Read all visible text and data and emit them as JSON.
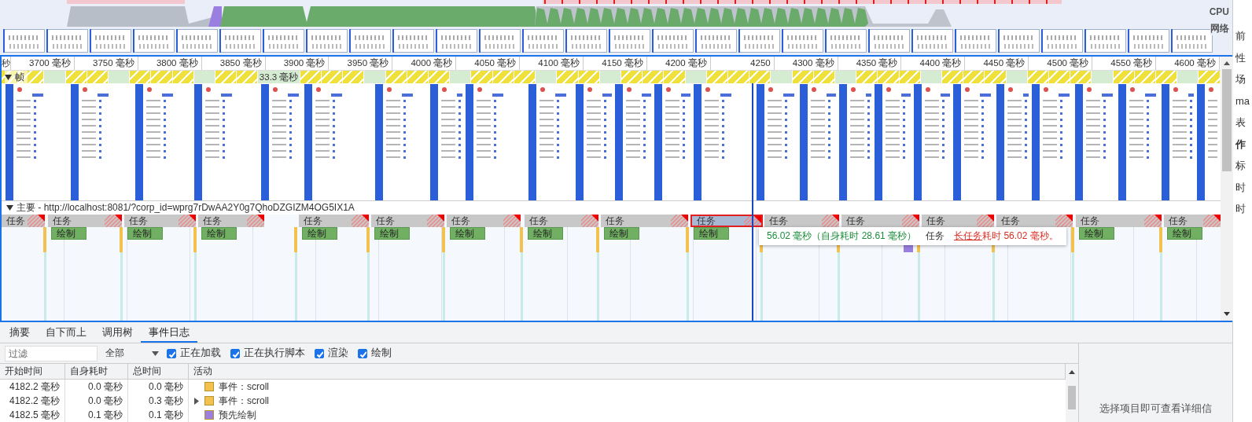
{
  "overview": {
    "cpu_label": "CPU",
    "network_label": "网络"
  },
  "side_panel": [
    {
      "text": "前",
      "emphasized": false
    },
    {
      "text": "性",
      "emphasized": false
    },
    {
      "text": "场",
      "emphasized": false
    },
    {
      "text": "ma",
      "emphasized": false
    },
    {
      "text": "表",
      "emphasized": false
    },
    {
      "text": "作",
      "emphasized": true
    },
    {
      "text": "标",
      "emphasized": false
    },
    {
      "text": "时",
      "emphasized": false
    },
    {
      "text": "时",
      "emphasized": false
    }
  ],
  "ruler": [
    "秒",
    "3700 毫秒",
    "3750 毫秒",
    "3800 毫秒",
    "3850 毫秒",
    "3900 毫秒",
    "3950 毫秒",
    "4000 毫秒",
    "4050 毫秒",
    "4100 毫秒",
    "4150 毫秒",
    "4200 毫秒",
    "4250",
    "4300 毫秒",
    "4350 毫秒",
    "4400 毫秒",
    "4450 毫秒",
    "4500 毫秒",
    "4550 毫秒",
    "4600 毫秒"
  ],
  "frames": {
    "label": "帧",
    "expanded": true,
    "items": [
      {
        "kind": "dropped"
      },
      {
        "kind": "dropped"
      },
      {
        "kind": "idle"
      },
      {
        "kind": "dropped"
      },
      {
        "kind": "dropped"
      },
      {
        "kind": "idle"
      },
      {
        "kind": "dropped"
      },
      {
        "kind": "dropped"
      },
      {
        "kind": "dropped"
      },
      {
        "kind": "idle"
      },
      {
        "kind": "dropped"
      },
      {
        "kind": "dropped"
      },
      {
        "kind": "idle",
        "label": "33.3 毫秒"
      },
      {
        "kind": "dropped"
      },
      {
        "kind": "dropped"
      },
      {
        "kind": "dropped"
      },
      {
        "kind": "idle"
      },
      {
        "kind": "dropped"
      },
      {
        "kind": "dropped"
      },
      {
        "kind": "dropped"
      },
      {
        "kind": "idle"
      },
      {
        "kind": "dropped"
      },
      {
        "kind": "dropped"
      },
      {
        "kind": "dropped"
      },
      {
        "kind": "idle"
      },
      {
        "kind": "dropped"
      },
      {
        "kind": "dropped"
      },
      {
        "kind": "idle"
      },
      {
        "kind": "dropped"
      },
      {
        "kind": "dropped"
      },
      {
        "kind": "dropped"
      },
      {
        "kind": "idle"
      },
      {
        "kind": "dropped"
      },
      {
        "kind": "dropped"
      },
      {
        "kind": "dropped"
      },
      {
        "kind": "idle"
      },
      {
        "kind": "dropped"
      },
      {
        "kind": "dropped"
      },
      {
        "kind": "idle"
      },
      {
        "kind": "dropped"
      },
      {
        "kind": "dropped"
      },
      {
        "kind": "dropped"
      },
      {
        "kind": "idle"
      },
      {
        "kind": "dropped"
      },
      {
        "kind": "dropped"
      },
      {
        "kind": "dropped"
      },
      {
        "kind": "idle"
      },
      {
        "kind": "dropped"
      },
      {
        "kind": "dropped"
      },
      {
        "kind": "dropped"
      },
      {
        "kind": "idle"
      },
      {
        "kind": "dropped"
      },
      {
        "kind": "dropped"
      },
      {
        "kind": "dropped"
      },
      {
        "kind": "idle"
      },
      {
        "kind": "dropped"
      }
    ]
  },
  "main_thread": {
    "title": "主要 - http://localhost:8081/?corp_id=wprg7rDwAA2Y0g7QhoDZGIZM4OG5IX1A",
    "expanded": true,
    "tasks": [
      {
        "label": "任务",
        "long_task": true,
        "selected": false
      },
      {
        "label": "任务",
        "paint": "绘制",
        "long_task": true,
        "selected": false
      },
      {
        "label": "任务",
        "paint": "绘制",
        "long_task": true,
        "selected": false
      },
      {
        "label": "任务",
        "paint": "绘制",
        "long_task": true,
        "selected": false
      },
      {
        "label": "任务",
        "paint": "绘制",
        "long_task": true,
        "selected": false
      },
      {
        "label": "任务",
        "paint": "绘制",
        "long_task": true,
        "selected": false
      },
      {
        "label": "任务",
        "paint": "绘制",
        "long_task": true,
        "selected": false
      },
      {
        "label": "任务",
        "paint": "绘制",
        "long_task": true,
        "selected": false
      },
      {
        "label": "任务",
        "paint": "绘制",
        "long_task": true,
        "selected": false
      },
      {
        "label": "任务",
        "paint": "绘制",
        "long_task": true,
        "selected": true
      },
      {
        "label": "任务",
        "long_task": true,
        "selected": false
      },
      {
        "label": "任务",
        "long_task": true,
        "selected": false
      },
      {
        "label": "任务",
        "long_task": true,
        "selected": false
      },
      {
        "label": "任务",
        "long_task": true,
        "selected": false
      },
      {
        "label": "任务",
        "paint": "绘制",
        "long_task": true,
        "selected": false
      },
      {
        "label": "任务",
        "paint": "绘制",
        "long_task": true,
        "selected": false
      }
    ],
    "tooltip": {
      "duration": "56.02 毫秒（自身耗时 28.61 毫秒）",
      "name": "任务",
      "link": "长任务",
      "warning": "耗时 56.02 毫秒。"
    }
  },
  "tabs": [
    {
      "label": "摘要",
      "selected": false
    },
    {
      "label": "自下而上",
      "selected": false
    },
    {
      "label": "调用树",
      "selected": false
    },
    {
      "label": "事件日志",
      "selected": true
    }
  ],
  "filter": {
    "placeholder": "过滤",
    "dropdown": "全部",
    "checkboxes": [
      {
        "label": "正在加载",
        "checked": true
      },
      {
        "label": "正在执行脚本",
        "checked": true
      },
      {
        "label": "渲染",
        "checked": true
      },
      {
        "label": "绘制",
        "checked": true
      }
    ]
  },
  "table": {
    "columns": [
      "开始时间",
      "自身耗时",
      "总时间",
      "活动"
    ],
    "rows": [
      {
        "start": "4182.2 毫秒",
        "self": "0.0 毫秒",
        "total": "0.0 毫秒",
        "activity": "事件：scroll",
        "color": "#f2c14e",
        "expandable": false
      },
      {
        "start": "4182.2 毫秒",
        "self": "0.0 毫秒",
        "total": "0.3 毫秒",
        "activity": "事件：scroll",
        "color": "#f2c14e",
        "expandable": true
      },
      {
        "start": "4182.5 毫秒",
        "self": "0.1 毫秒",
        "total": "0.1 毫秒",
        "activity": "预先绘制",
        "color": "#9b7fe0",
        "expandable": false
      }
    ]
  },
  "details": {
    "hint": "选择项目即可查看详细信"
  }
}
